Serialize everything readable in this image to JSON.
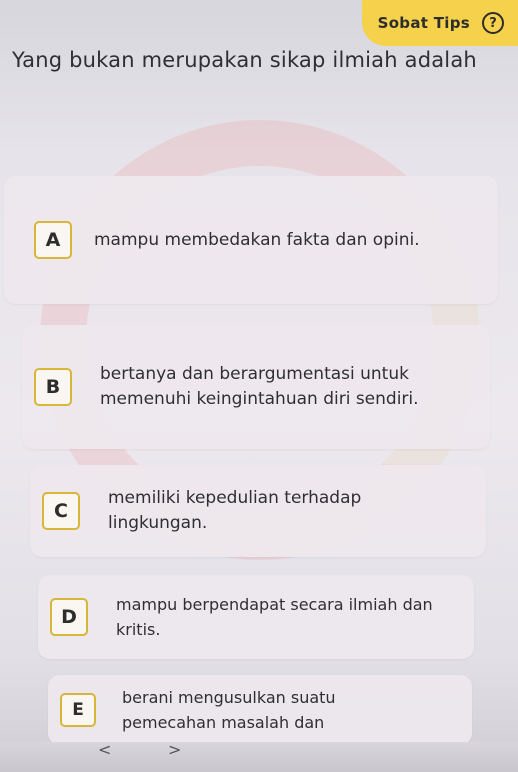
{
  "header": {
    "tips_label": "Sobat Tips",
    "help_icon": "?"
  },
  "question": {
    "text": "Yang bukan merupakan sikap ilmiah adalah"
  },
  "options": [
    {
      "letter": "A",
      "text": "mampu membedakan fakta dan opini."
    },
    {
      "letter": "B",
      "text": "bertanya dan berargumentasi untuk memenuhi keingintahuan diri sendiri."
    },
    {
      "letter": "C",
      "text": "memiliki kepedulian terhadap lingkungan."
    },
    {
      "letter": "D",
      "text": "mampu berpendapat secara ilmiah dan kritis."
    },
    {
      "letter": "E",
      "text": "berani mengusulkan suatu pemecahan masalah dan"
    }
  ],
  "nav": {
    "prev": "<",
    "next": ">"
  },
  "colors": {
    "tips_bg": "#f6d24c",
    "letter_border": "#d8b63a"
  }
}
